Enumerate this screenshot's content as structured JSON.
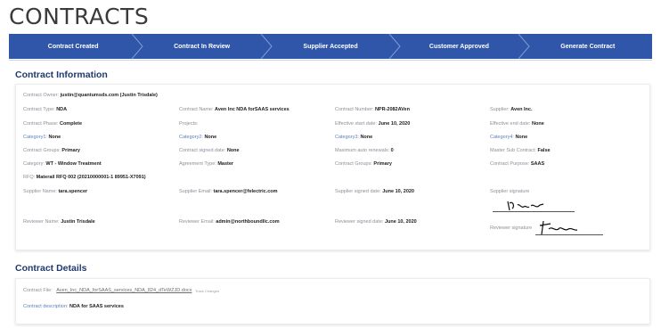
{
  "page": {
    "title": "CONTRACTS"
  },
  "stepper": {
    "steps": [
      "Contract Created",
      "Contract In Review",
      "Supplier Accepted",
      "Customer Approved",
      "Generate Contract"
    ],
    "color": "#2f56a8"
  },
  "info": {
    "heading": "Contract Information",
    "owner": {
      "label": "Contract Owner:",
      "value": "justin@quantumsds.com (Justin Trisdale)"
    },
    "rows": [
      [
        {
          "label": "Contract Type:",
          "value": "NDA"
        },
        {
          "label": "Contract Name:",
          "value": "Aven Inc NDA forSAAS services"
        },
        {
          "label": "Contract Number:",
          "value": "NPR-2082AVen"
        },
        {
          "label": "Supplier:",
          "value": "Aven Inc."
        }
      ],
      [
        {
          "label": "Contract Phase:",
          "value": "Complete"
        },
        {
          "label": "Projects:",
          "value": ""
        },
        {
          "label": "Effective start date:",
          "value": "June 10, 2020"
        },
        {
          "label": "Effective end date:",
          "value": "None"
        }
      ],
      [
        {
          "label": "Category1:",
          "value": "None"
        },
        {
          "label": "Category2:",
          "value": "None"
        },
        {
          "label": "Category3:",
          "value": "None"
        },
        {
          "label": "Category4:",
          "value": "None"
        }
      ],
      [
        {
          "label": "Contract Groups:",
          "value": "Primary"
        },
        {
          "label": "Contract signed date:",
          "value": "None"
        },
        {
          "label": "Maximum auto renewals:",
          "value": "0"
        },
        {
          "label": "Master Sub Contract:",
          "value": "False"
        }
      ],
      [
        {
          "label": "Category:",
          "value": "WT - Window Treatment"
        },
        {
          "label": "Agreement Type:",
          "value": "Master"
        },
        {
          "label": "Contract Groups:",
          "value": "Primary"
        },
        {
          "label": "Contract Purpose:",
          "value": "SAAS"
        }
      ]
    ],
    "rfq": {
      "label": "RFQ:",
      "value": "Materail RFQ 002 (20210000001-1 89951-X7091)"
    },
    "supplier_sign": [
      {
        "label": "Supplier Name:",
        "value": "tara.spencer"
      },
      {
        "label": "Supplier Email:",
        "value": "tara.spencer@felectric.com"
      },
      {
        "label": "Supplier signed date:",
        "value": "June 10, 2020"
      },
      {
        "label": "Supplier signature",
        "value": ""
      }
    ],
    "reviewer_sign": [
      {
        "label": "Reviewer Name:",
        "value": "Justin Trisdale"
      },
      {
        "label": "Reviewer Email:",
        "value": "admin@northboundllc.com"
      },
      {
        "label": "Reviewer signed date:",
        "value": "June 10, 2020"
      },
      {
        "label": "Reviewer signature",
        "value": ""
      }
    ]
  },
  "details": {
    "heading": "Contract Details",
    "file": {
      "label": "Contract File:",
      "value": "Aven_Inc_NDA_forSAAS_services_NDA_824_dTeWZJD.docx",
      "tag": "Track Changes"
    },
    "description": {
      "label": "Contract description:",
      "value": "NDA for SAAS services"
    }
  }
}
